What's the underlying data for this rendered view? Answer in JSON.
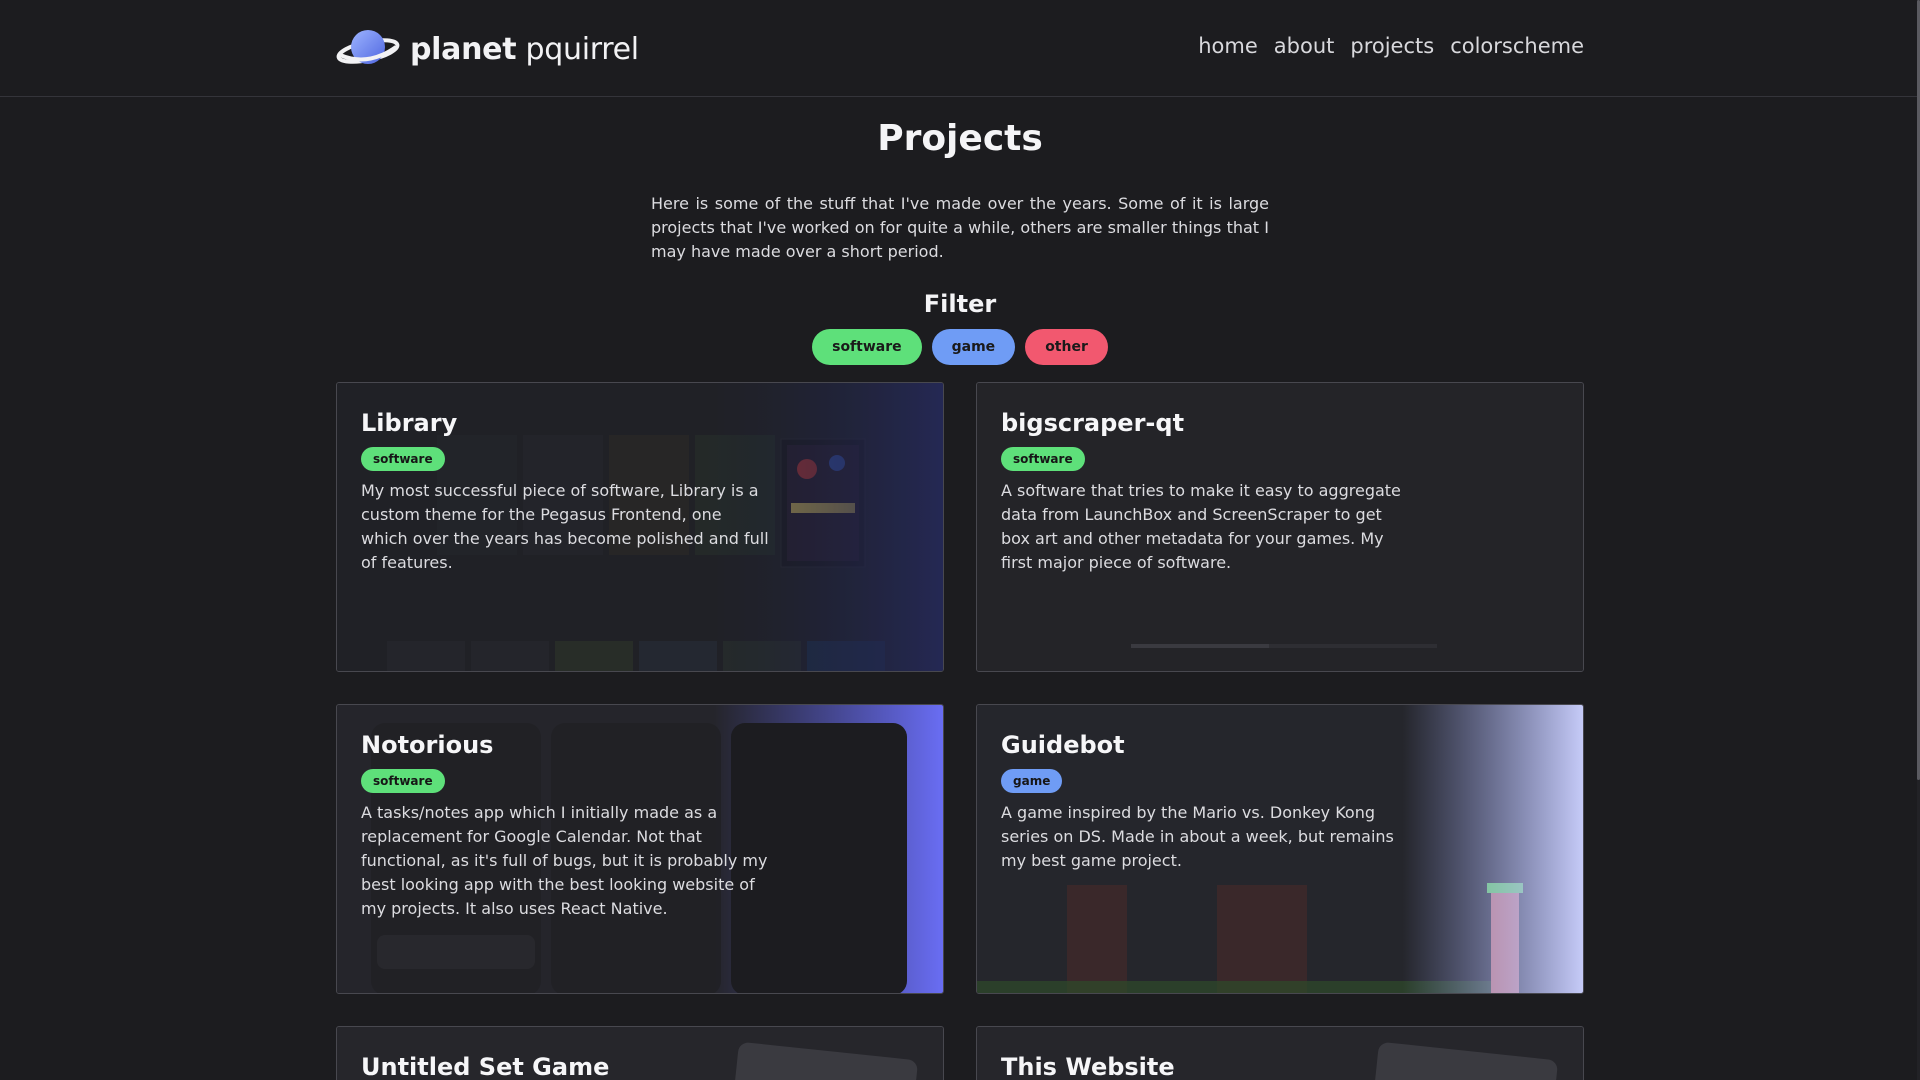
{
  "header": {
    "logo_bold": "planet",
    "logo_regular": "pquirrel",
    "nav": [
      "home",
      "about",
      "projects",
      "colorscheme"
    ]
  },
  "main": {
    "title": "Projects",
    "intro": "Here is some of the stuff that I've made over the years. Some of it is large projects that I've worked on for quite a while, others are smaller things that I may have made over a short period.",
    "filter_title": "Filter",
    "filters": [
      "software",
      "game",
      "other"
    ]
  },
  "projects": [
    {
      "title": "Library",
      "tag": "software",
      "description": "My most successful piece of software, Library is a custom theme for the Pegasus Frontend, one which over the years has become polished and full of features."
    },
    {
      "title": "bigscraper-qt",
      "tag": "software",
      "description": "A software that tries to make it easy to aggregate data from LaunchBox and ScreenScraper to get box art and other metadata for your games. My first major piece of software."
    },
    {
      "title": "Notorious",
      "tag": "software",
      "description": "A tasks/notes app which I initially made as a replacement for Google Calendar. Not that functional, as it's full of bugs, but it is probably my best looking app with the best looking website of my projects. It also uses React Native."
    },
    {
      "title": "Guidebot",
      "tag": "game",
      "description": "A game inspired by the Mario vs. Donkey Kong series on DS. Made in about a week, but remains my best game project."
    },
    {
      "title": "Untitled Set Game"
    },
    {
      "title": "This Website"
    }
  ],
  "colors": {
    "background": "#1c1c1f",
    "software": "#5ee07a",
    "game": "#6f9cf5",
    "other": "#f2586f"
  }
}
